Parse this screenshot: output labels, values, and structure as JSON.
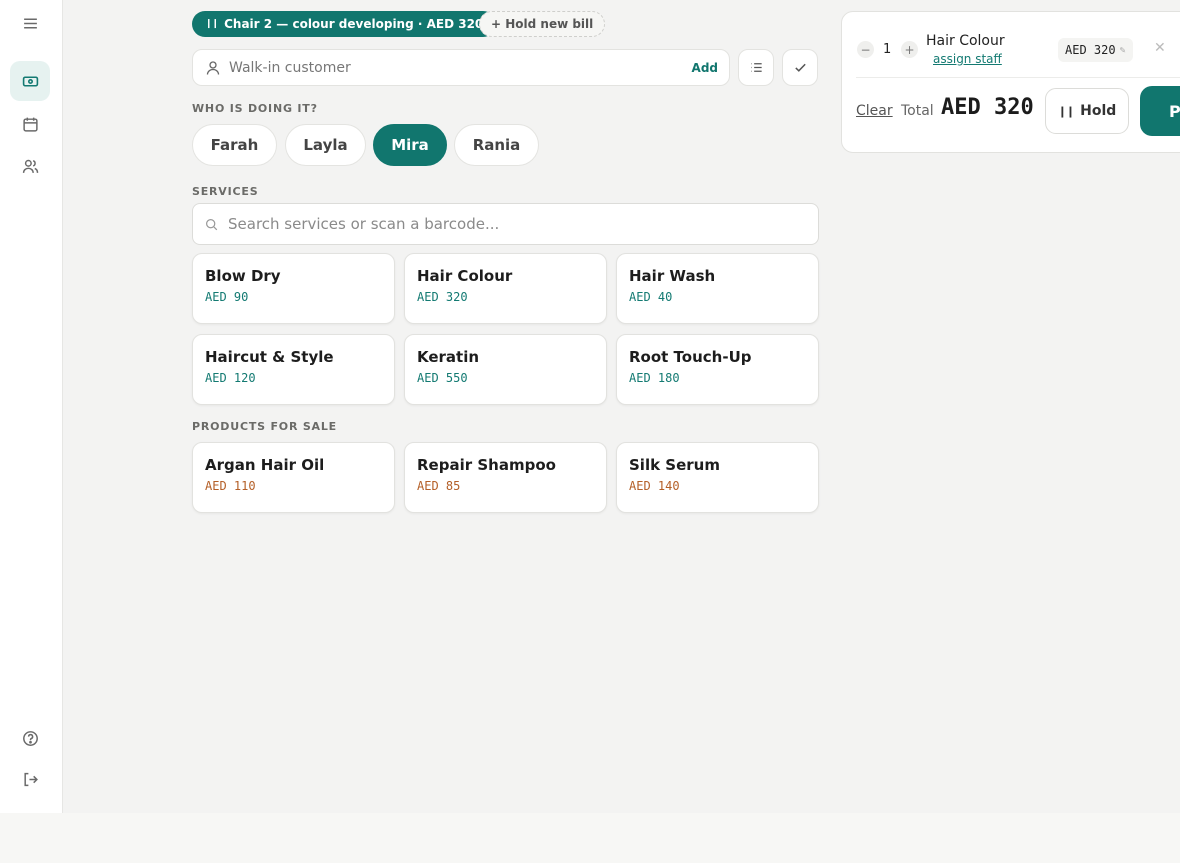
{
  "colors": {
    "accent": "#11766e",
    "service_price": "#137a72",
    "product_price": "#b45f27"
  },
  "sidebar": {
    "items": [
      {
        "icon": "menu-icon"
      },
      {
        "icon": "register-icon",
        "active": true
      },
      {
        "icon": "calendar-icon"
      },
      {
        "icon": "users-icon"
      },
      {
        "icon": "help-icon"
      },
      {
        "icon": "logout-icon"
      }
    ]
  },
  "bills": {
    "held": "Chair 2 — colour developing · AED 320",
    "new_label": "+ Hold new bill"
  },
  "customer": {
    "placeholder": "Walk-in customer",
    "add_label": "Add"
  },
  "staff": {
    "heading": "WHO IS DOING IT?",
    "members": [
      "Farah",
      "Layla",
      "Mira",
      "Rania"
    ],
    "selected": "Mira"
  },
  "services": {
    "heading": "SERVICES",
    "search_placeholder": "Search services or scan a barcode...",
    "items": [
      {
        "name": "Blow Dry",
        "price": "AED 90"
      },
      {
        "name": "Hair Colour",
        "price": "AED 320"
      },
      {
        "name": "Hair Wash",
        "price": "AED 40"
      },
      {
        "name": "Haircut & Style",
        "price": "AED 120"
      },
      {
        "name": "Keratin",
        "price": "AED 550"
      },
      {
        "name": "Root Touch-Up",
        "price": "AED 180"
      }
    ]
  },
  "products": {
    "heading": "PRODUCTS FOR SALE",
    "items": [
      {
        "name": "Argan Hair Oil",
        "price": "AED 110"
      },
      {
        "name": "Repair Shampoo",
        "price": "AED 85"
      },
      {
        "name": "Silk Serum",
        "price": "AED 140"
      }
    ]
  },
  "cart": {
    "line": {
      "qty": "1",
      "name": "Hair Colour",
      "assign": "assign staff",
      "price": "AED 320"
    },
    "clear": "Clear",
    "total_label": "Total",
    "total": "AED 320",
    "hold": "Hold",
    "pay": "P"
  }
}
